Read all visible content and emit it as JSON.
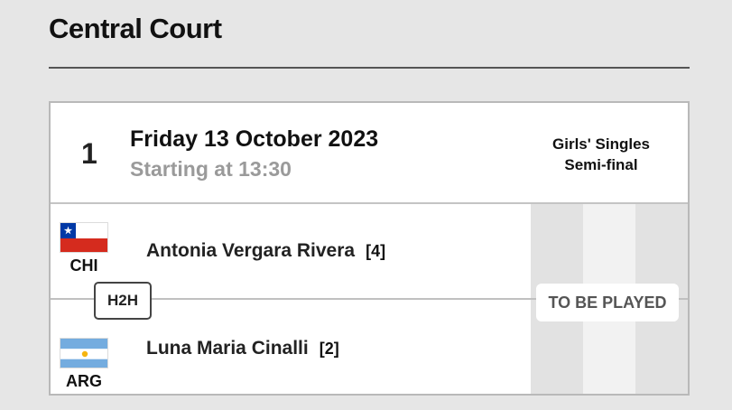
{
  "court": {
    "title": "Central Court"
  },
  "match": {
    "number": "1",
    "date": "Friday 13 October 2023",
    "start_time": "Starting at 13:30",
    "event_line1": "Girls' Singles",
    "event_line2": "Semi-final",
    "status": "TO BE PLAYED",
    "h2h_label": "H2H"
  },
  "players": [
    {
      "name": "Antonia  Vergara Rivera",
      "seed": "[4]",
      "country_code": "CHI",
      "flag_icon": "chile-flag-icon"
    },
    {
      "name": "Luna Maria  Cinalli",
      "seed": "[2]",
      "country_code": "ARG",
      "flag_icon": "argentina-flag-icon"
    }
  ],
  "colors": {
    "background": "#e6e6e6",
    "card": "#ffffff",
    "muted_text": "#9a9a9a",
    "chile_red": "#d52b1e",
    "chile_blue": "#0039a6",
    "argentina_blue": "#74acdf",
    "argentina_sun": "#f6b40e"
  }
}
